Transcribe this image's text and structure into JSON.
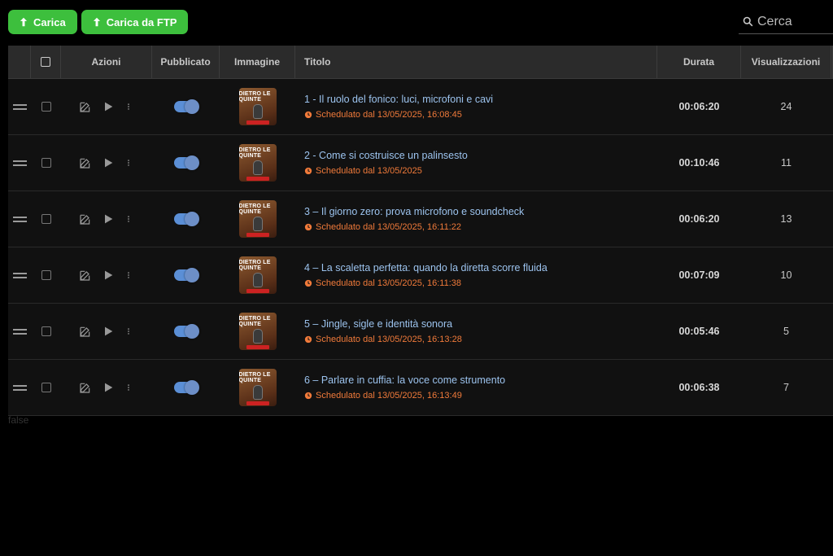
{
  "toolbar": {
    "upload_label": "Carica",
    "upload_ftp_label": "Carica da FTP"
  },
  "search": {
    "placeholder": "Cerca"
  },
  "table": {
    "headers": {
      "actions": "Azioni",
      "published": "Pubblicato",
      "image": "Immagine",
      "title": "Titolo",
      "duration": "Durata",
      "views": "Visualizzazioni"
    },
    "thumbnail_text": "DIETRO LE QUINTE",
    "rows": [
      {
        "title": "1 - Il ruolo del fonico: luci, microfoni e cavi",
        "scheduled": "Schedulato dal 13/05/2025, 16:08:45",
        "duration": "00:06:20",
        "views": "24",
        "published": true
      },
      {
        "title": "2 - Come si costruisce un palinsesto",
        "scheduled": "Schedulato dal 13/05/2025",
        "duration": "00:10:46",
        "views": "11",
        "published": true
      },
      {
        "title": "3 – Il giorno zero: prova microfono e soundcheck",
        "scheduled": "Schedulato dal 13/05/2025, 16:11:22",
        "duration": "00:06:20",
        "views": "13",
        "published": true
      },
      {
        "title": "4 – La scaletta perfetta: quando la diretta scorre fluida",
        "scheduled": "Schedulato dal 13/05/2025, 16:11:38",
        "duration": "00:07:09",
        "views": "10",
        "published": true
      },
      {
        "title": "5 – Jingle, sigle e identità sonora",
        "scheduled": "Schedulato dal 13/05/2025, 16:13:28",
        "duration": "00:05:46",
        "views": "5",
        "published": true
      },
      {
        "title": "6 – Parlare in cuffia: la voce come strumento",
        "scheduled": "Schedulato dal 13/05/2025, 16:13:49",
        "duration": "00:06:38",
        "views": "7",
        "published": true
      }
    ]
  },
  "footer_text": "false",
  "colors": {
    "accent_green": "#3dbf3d",
    "link": "#9cc3ee",
    "schedule": "#f07a3a",
    "toggle": "#5b8fd6"
  }
}
